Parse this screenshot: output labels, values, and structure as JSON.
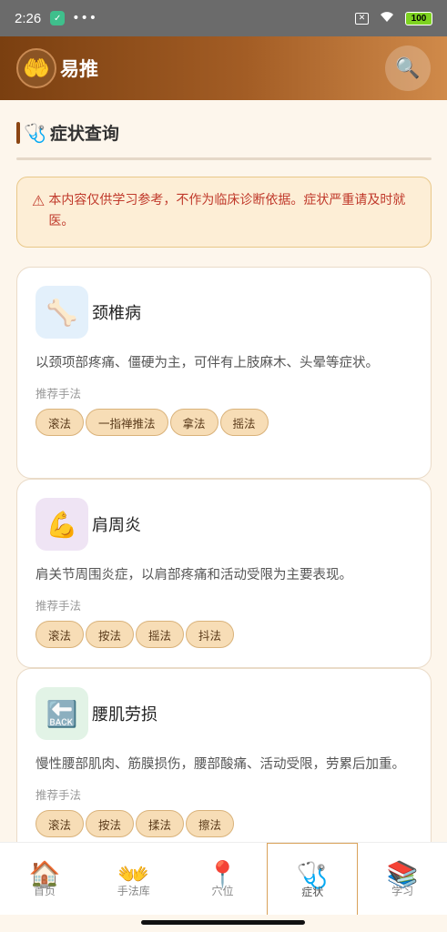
{
  "status_bar": {
    "time": "2:26",
    "dots": "•••",
    "battery": "100"
  },
  "header": {
    "logo_icon": "🤲",
    "title": "易推",
    "search_icon": "🔍"
  },
  "section": {
    "icon": "🩺",
    "title": "症状查询"
  },
  "warning": {
    "icon": "⚠",
    "text": "本内容仅供学习参考，不作为临床诊断依据。症状严重请及时就医。"
  },
  "recommend_label": "推荐手法",
  "cards": [
    {
      "icon": "🦴",
      "icon_bg": "#e3f0fb",
      "title": "颈椎病",
      "desc": "以颈项部疼痛、僵硬为主，可伴有上肢麻木、头晕等症状。",
      "tags": [
        "滚法",
        "一指禅推法",
        "拿法",
        "摇法"
      ]
    },
    {
      "icon": "💪",
      "icon_bg": "#efe4f4",
      "title": "肩周炎",
      "desc": "肩关节周围炎症，以肩部疼痛和活动受限为主要表现。",
      "tags": [
        "滚法",
        "按法",
        "摇法",
        "抖法"
      ]
    },
    {
      "icon": "🔙",
      "icon_bg": "#e2f3e6",
      "title": "腰肌劳损",
      "desc": "慢性腰部肌肉、筋膜损伤，腰部酸痛、活动受限，劳累后加重。",
      "tags": [
        "滚法",
        "按法",
        "揉法",
        "擦法"
      ]
    }
  ],
  "nav": [
    {
      "icon": "🏠",
      "label": "首页"
    },
    {
      "icon": "👐",
      "label": "手法库"
    },
    {
      "icon": "📍",
      "label": "穴位"
    },
    {
      "icon": "🩺",
      "label": "症状"
    },
    {
      "icon": "📚",
      "label": "学习"
    }
  ],
  "colors": {
    "accent": "#8b4513",
    "warning": "#c0392b",
    "tag_bg": "#f7ddb6"
  }
}
